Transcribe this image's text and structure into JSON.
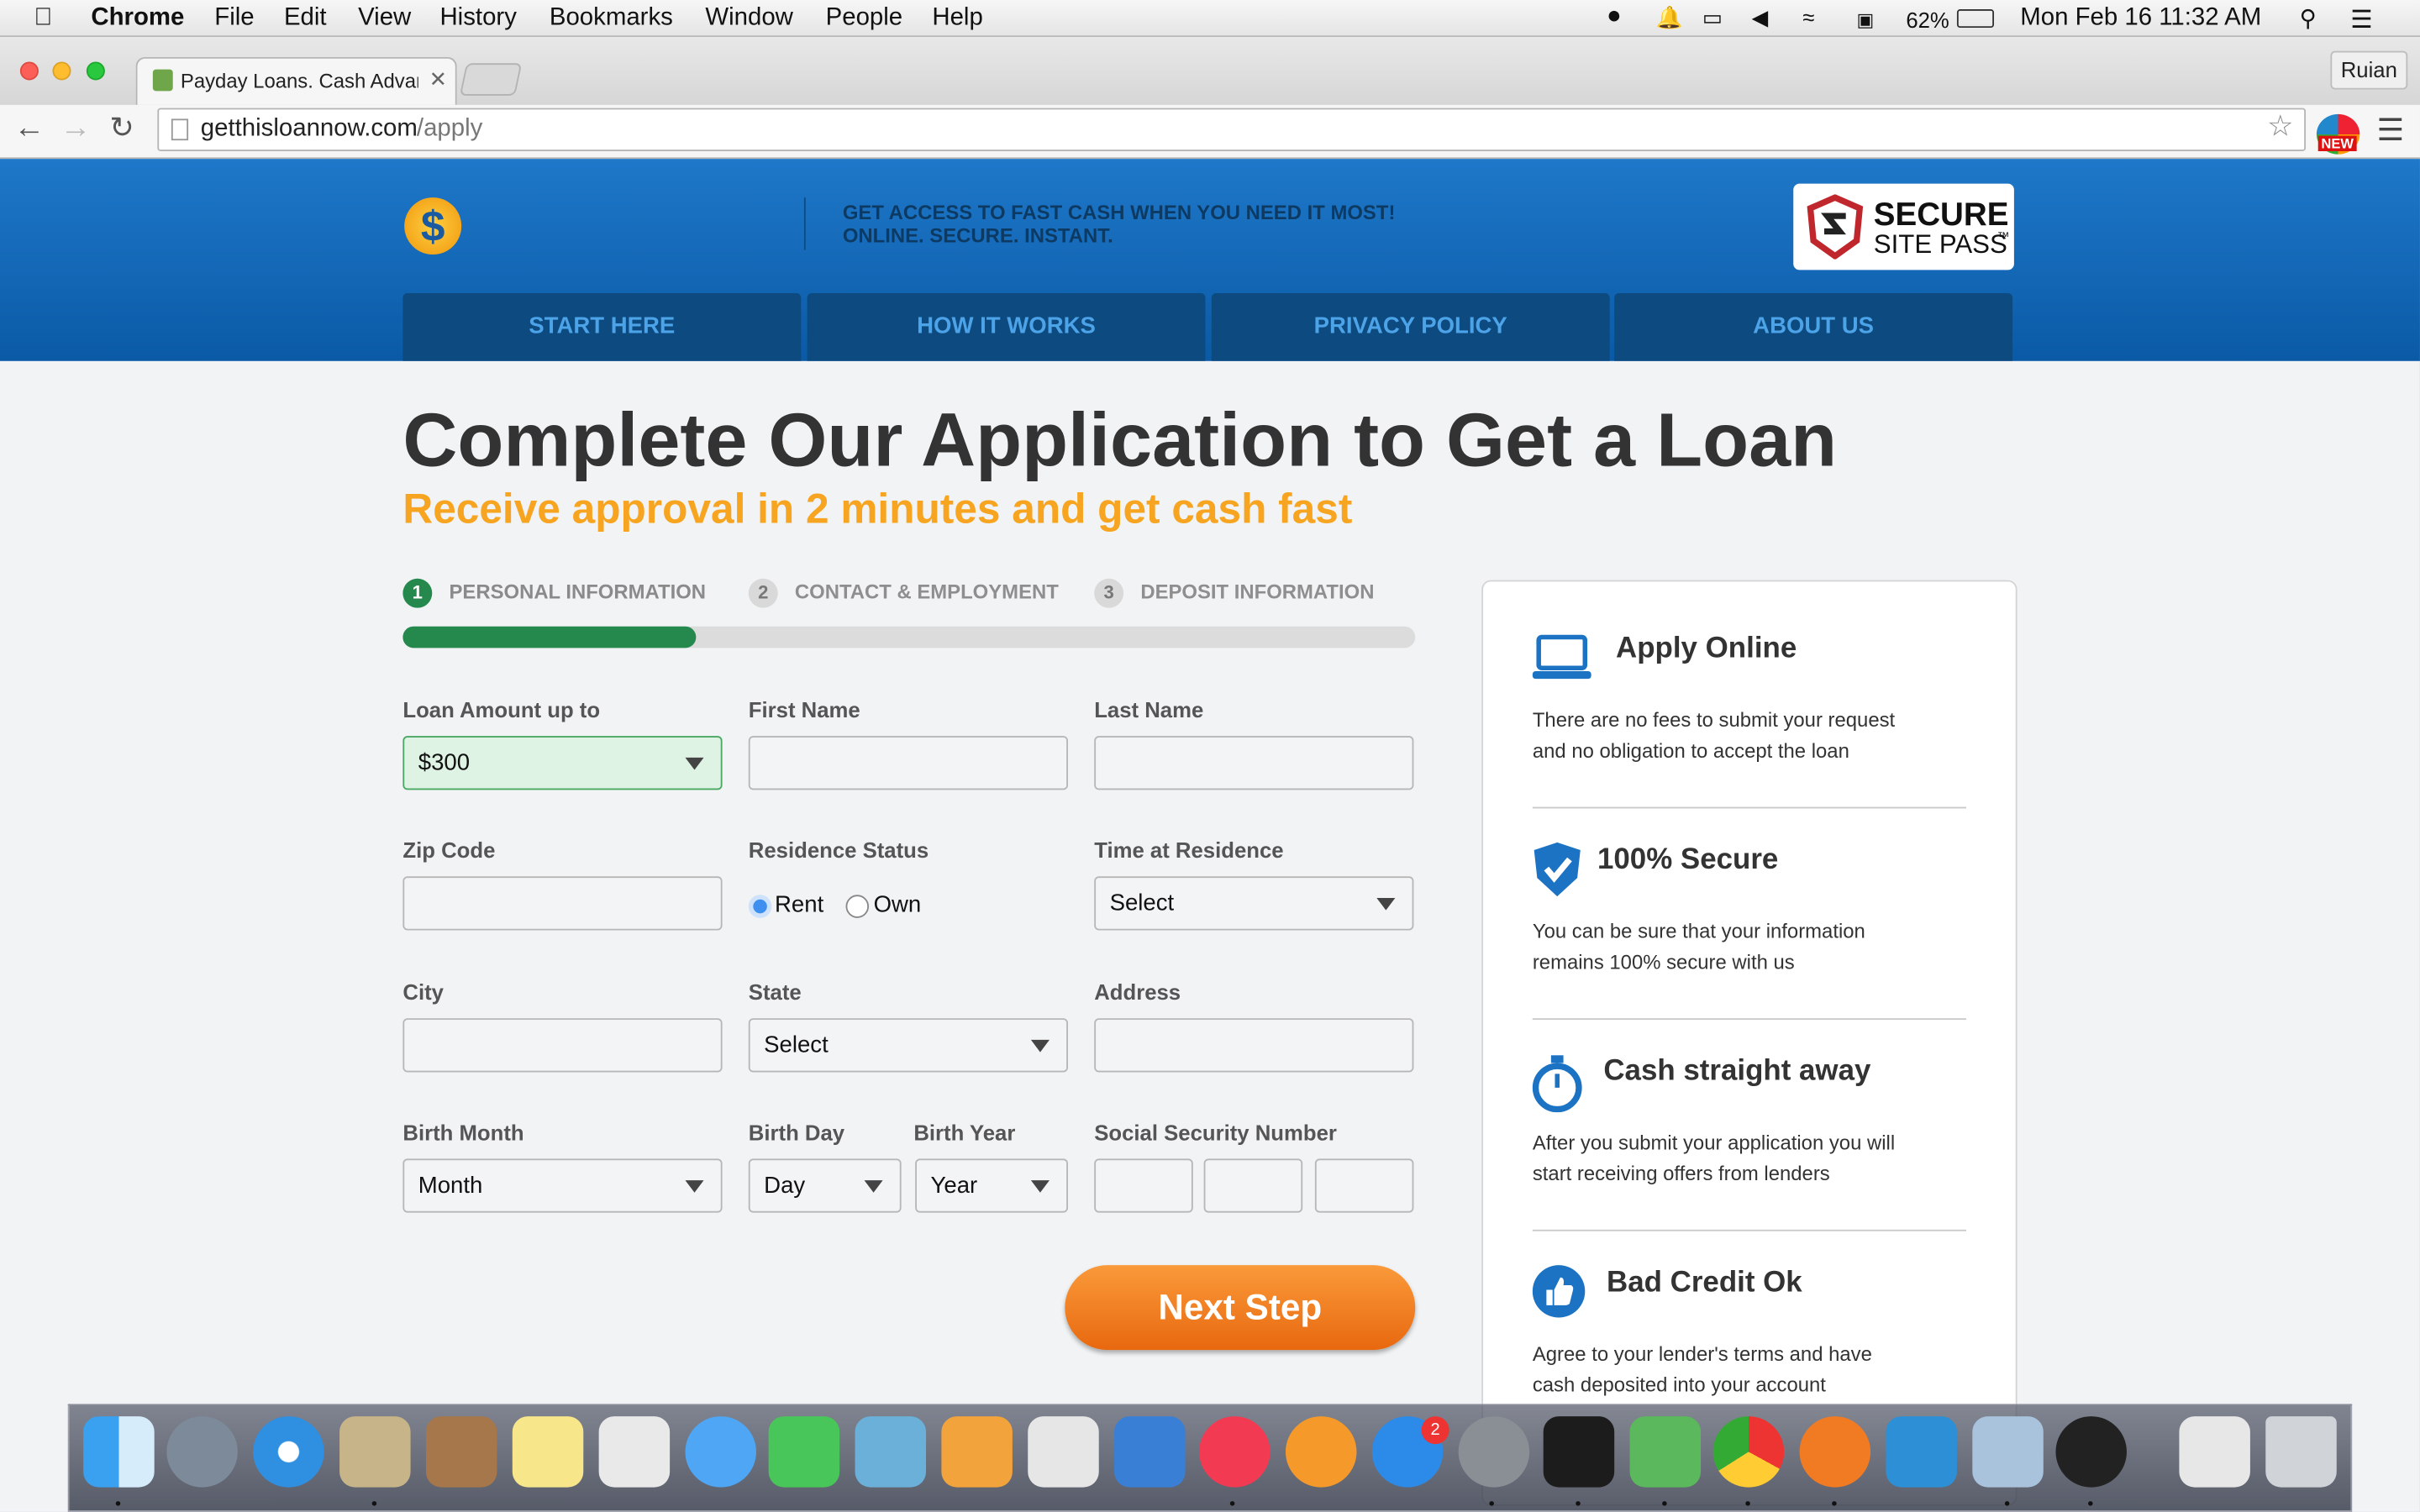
{
  "menubar": {
    "app": "Chrome",
    "items": [
      "File",
      "Edit",
      "View",
      "History",
      "Bookmarks",
      "Window",
      "People",
      "Help"
    ],
    "battery": "62%",
    "clock": "Mon Feb 16  11:32 AM"
  },
  "browser": {
    "tab_title": "Payday Loans. Cash Advan",
    "profile": "Ruian",
    "url_domain": "getthisloannow.com",
    "url_path": "/apply"
  },
  "site": {
    "tagline": "GET ACCESS TO FAST CASH WHEN YOU NEED IT MOST! ONLINE. SECURE. INSTANT.",
    "seal_line1": "SECURE",
    "seal_line2": "SITE PASS",
    "seal_tm": "™",
    "nav": [
      "START HERE",
      "HOW IT WORKS",
      "PRIVACY POLICY",
      "ABOUT US"
    ]
  },
  "page": {
    "title": "Complete Our Application to Get a Loan",
    "subtitle": "Receive approval in 2 minutes and get cash fast"
  },
  "steps": [
    {
      "num": "1",
      "label": "PERSONAL INFORMATION"
    },
    {
      "num": "2",
      "label": "CONTACT & EMPLOYMENT"
    },
    {
      "num": "3",
      "label": "DEPOSIT INFORMATION"
    }
  ],
  "progress_fraction": 0.29,
  "form": {
    "loan_label": "Loan Amount up to",
    "loan_value": "$300",
    "first_name": "First Name",
    "last_name": "Last Name",
    "zip": "Zip Code",
    "residence": "Residence Status",
    "rent": "Rent",
    "own": "Own",
    "time": "Time at Residence",
    "time_value": "Select",
    "city": "City",
    "state": "State",
    "state_value": "Select",
    "address": "Address",
    "birth_month": "Birth Month",
    "month_value": "Month",
    "birth_day": "Birth Day",
    "day_value": "Day",
    "birth_year": "Birth Year",
    "year_value": "Year",
    "ssn": "Social Security Number",
    "next": "Next Step"
  },
  "features": [
    {
      "title": "Apply Online",
      "desc": "There are no fees to submit your request and no obligation to accept the loan",
      "icon": "laptop-icon"
    },
    {
      "title": "100% Secure",
      "desc": "You can be sure that your information remains 100% secure with us",
      "icon": "shield-check-icon"
    },
    {
      "title": "Cash straight away",
      "desc": "After you submit your application you will start receiving offers from lenders",
      "icon": "stopwatch-icon"
    },
    {
      "title": "Bad Credit Ok",
      "desc": "Agree to your lender's terms and have cash deposited into your account",
      "icon": "thumbs-up-icon"
    }
  ],
  "dock": {
    "appstore_badge": "2",
    "colors": {
      "accent_green": "#25894e",
      "accent_orange": "#f7a521",
      "header_blue": "#0a5aa6"
    }
  }
}
